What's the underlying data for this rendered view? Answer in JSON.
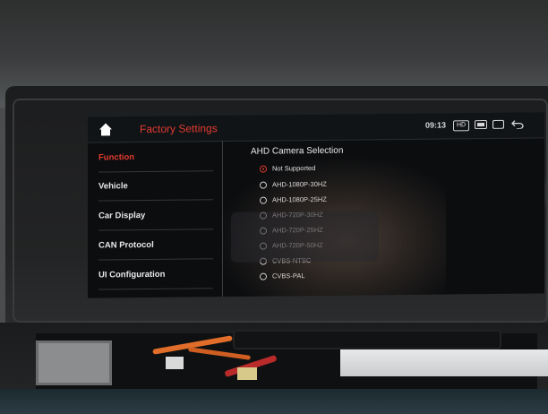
{
  "header": {
    "title": "Factory Settings",
    "time": "09:13",
    "hd_badge": "HD"
  },
  "sidebar": {
    "items": [
      {
        "label": "Function",
        "active": true
      },
      {
        "label": "Vehicle",
        "active": false
      },
      {
        "label": "Car Display",
        "active": false
      },
      {
        "label": "CAN Protocol",
        "active": false
      },
      {
        "label": "UI Configuration",
        "active": false
      }
    ]
  },
  "main": {
    "section_title": "AHD Camera Selection",
    "options": [
      {
        "label": "Not Supported",
        "selected": true
      },
      {
        "label": "AHD-1080P-30HZ",
        "selected": false
      },
      {
        "label": "AHD-1080P-25HZ",
        "selected": false
      },
      {
        "label": "AHD-720P-30HZ",
        "selected": false
      },
      {
        "label": "AHD-720P-25HZ",
        "selected": false
      },
      {
        "label": "AHD-720P-50HZ",
        "selected": false
      },
      {
        "label": "CVBS-NTSC",
        "selected": false
      },
      {
        "label": "CVBS-PAL",
        "selected": false
      }
    ]
  },
  "colors": {
    "accent": "#e13a2e",
    "background": "#0b0d0f",
    "text": "#e8e8e8"
  },
  "icons": [
    "home-icon",
    "image-icon",
    "window-icon",
    "back-icon"
  ]
}
